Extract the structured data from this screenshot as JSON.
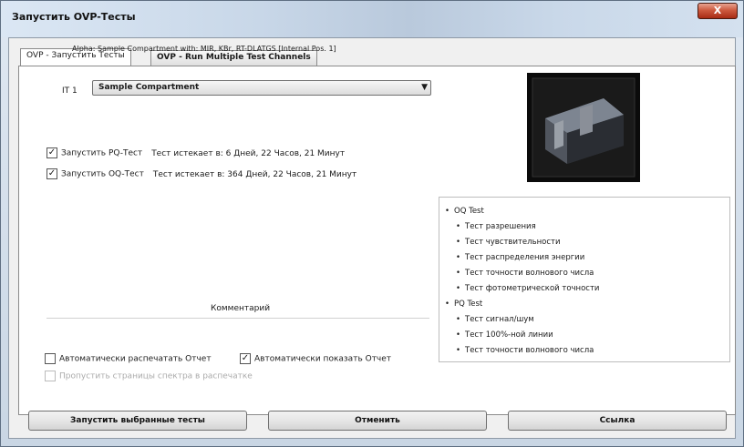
{
  "window": {
    "title": "Запустить OVP-Тесты",
    "close_label": "X"
  },
  "tabs": [
    {
      "label": "OVP - Запустить Тесты",
      "active": true
    },
    {
      "label": "OVP - Run Multiple Test Channels",
      "active": false
    }
  ],
  "alpha_text": "Alpha: Sample Compartment with: MIR, KBr, RT-DLATGS [Internal Pos. 1]",
  "it_label": "IT 1",
  "compartment_select": {
    "value": "Sample Compartment"
  },
  "tests": [
    {
      "label": "Запустить PQ-Тест",
      "checked": true,
      "expiry": "Тест истекает в: 6 Дней, 22 Часов, 21 Минут"
    },
    {
      "label": "Запустить OQ-Тест",
      "checked": true,
      "expiry": "Тест истекает в: 364 Дней, 22 Часов, 21 Минут"
    }
  ],
  "test_list": [
    {
      "text": "OQ Test",
      "level": 0
    },
    {
      "text": "Тест разрешения",
      "level": 1
    },
    {
      "text": "Тест чувствительности",
      "level": 1
    },
    {
      "text": "Тест распределения энергии",
      "level": 1
    },
    {
      "text": "Тест точности волнового числа",
      "level": 1
    },
    {
      "text": "Тест фотометрической точности",
      "level": 1
    },
    {
      "text": "PQ Test",
      "level": 0
    },
    {
      "text": "Тест сигнал/шум",
      "level": 1
    },
    {
      "text": "Тест 100%-ной линии",
      "level": 1
    },
    {
      "text": "Тест точности волнового числа",
      "level": 1
    }
  ],
  "comment_label": "Комментарий",
  "options": {
    "auto_print": {
      "label": "Автоматически распечатать Отчет",
      "checked": false
    },
    "auto_show": {
      "label": "Автоматически показать Отчет",
      "checked": true
    },
    "skip_spectra": {
      "label": "Пропустить страницы спектра в распечатке",
      "checked": false,
      "disabled": true
    }
  },
  "buttons": {
    "run": "Запустить выбранные тесты",
    "cancel": "Отменить",
    "help": "Ссылка"
  }
}
